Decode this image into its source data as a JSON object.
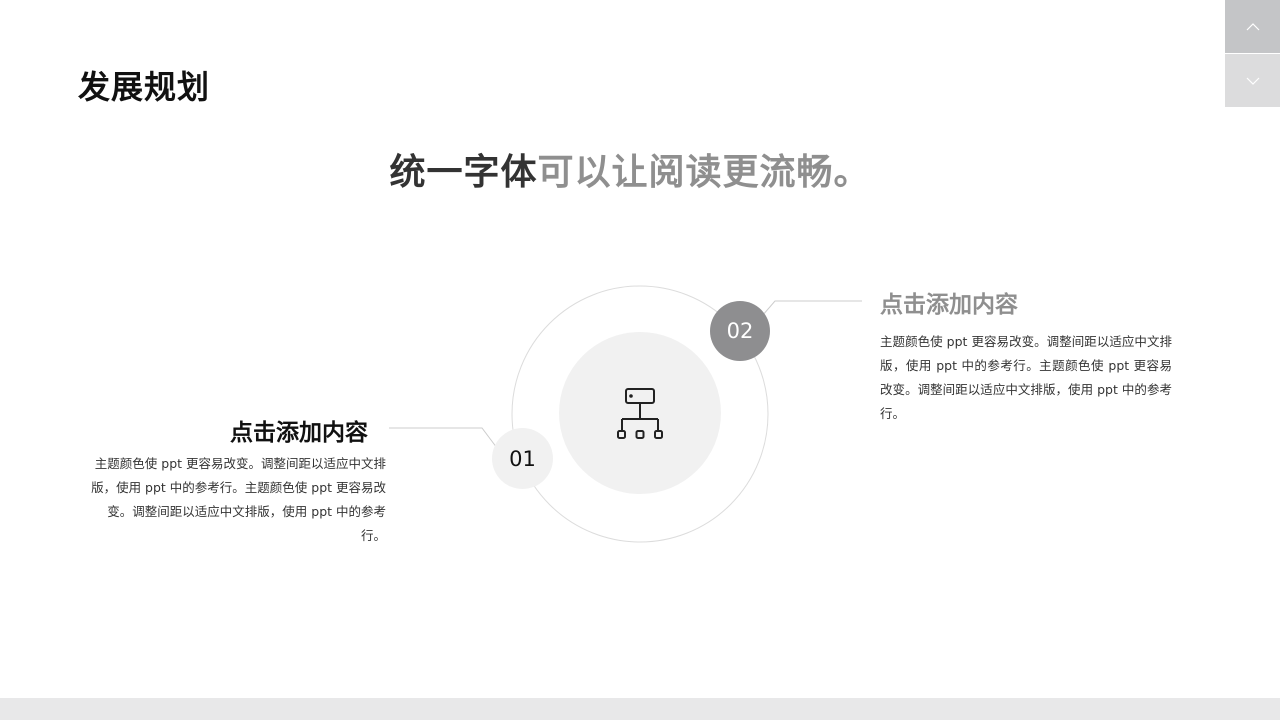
{
  "page": {
    "title": "发展规划"
  },
  "headline": {
    "dark_part": "统一字体",
    "light_part": "可以让阅读更流畅。"
  },
  "nav": {
    "up_icon": "chevron-up-icon",
    "down_icon": "chevron-down-icon"
  },
  "diagram": {
    "center_icon": "hierarchy-icon",
    "items": [
      {
        "number": "01",
        "title": "点击添加内容",
        "body": "主题颜色使 ppt 更容易改变。调整间距以适应中文排版，使用 ppt 中的参考行。主题颜色使 ppt 更容易改变。调整间距以适应中文排版，使用 ppt 中的参考行。"
      },
      {
        "number": "02",
        "title": "点击添加内容",
        "body": "主题颜色使 ppt 更容易改变。调整间距以适应中文排版，使用 ppt 中的参考行。主题颜色使 ppt 更容易改变。调整间距以适应中文排版，使用 ppt 中的参考行。"
      }
    ]
  },
  "colors": {
    "accent_dark": "#333333",
    "accent_gray": "#8f8f8f",
    "circle_light": "#f1f1f1",
    "circle_dark": "#8e8e90",
    "nav_up_bg": "#c4c5c7",
    "nav_down_bg": "#dcdcdd",
    "footer_bg": "#e8e8e9"
  }
}
